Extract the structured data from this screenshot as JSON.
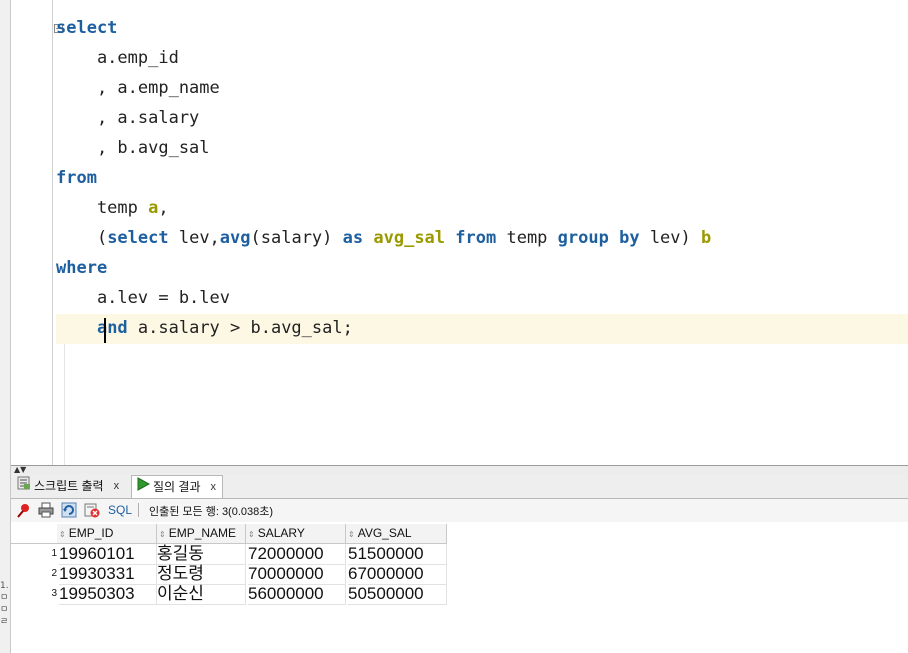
{
  "editor": {
    "lines": [
      [
        {
          "t": "select",
          "c": "kw"
        }
      ],
      [
        {
          "t": "    a.emp_id",
          "c": ""
        }
      ],
      [
        {
          "t": "    , a.emp_name",
          "c": ""
        }
      ],
      [
        {
          "t": "    , a.salary",
          "c": ""
        }
      ],
      [
        {
          "t": "    , b.avg_sal",
          "c": ""
        }
      ],
      [
        {
          "t": "from",
          "c": "kw"
        }
      ],
      [
        {
          "t": "    temp ",
          "c": ""
        },
        {
          "t": "a",
          "c": "al"
        },
        {
          "t": ",",
          "c": ""
        }
      ],
      [
        {
          "t": "    (",
          "c": ""
        },
        {
          "t": "select",
          "c": "kw"
        },
        {
          "t": " lev,",
          "c": ""
        },
        {
          "t": "avg",
          "c": "kw"
        },
        {
          "t": "(salary) ",
          "c": ""
        },
        {
          "t": "as",
          "c": "kw"
        },
        {
          "t": " ",
          "c": ""
        },
        {
          "t": "avg_sal",
          "c": "al"
        },
        {
          "t": " ",
          "c": ""
        },
        {
          "t": "from",
          "c": "kw"
        },
        {
          "t": " temp ",
          "c": ""
        },
        {
          "t": "group",
          "c": "kw"
        },
        {
          "t": " ",
          "c": ""
        },
        {
          "t": "by",
          "c": "kw"
        },
        {
          "t": " lev) ",
          "c": ""
        },
        {
          "t": "b",
          "c": "al"
        }
      ],
      [
        {
          "t": "where",
          "c": "kw"
        }
      ],
      [
        {
          "t": "    a.lev = b.lev",
          "c": ""
        }
      ],
      [
        {
          "t": "    ",
          "c": ""
        },
        {
          "t": "and",
          "c": "kw"
        },
        {
          "t": " a.salary > b.avg_sal;",
          "c": ""
        }
      ]
    ],
    "fold_symbol": "−"
  },
  "tabs": {
    "script_output": "스크립트 출력",
    "query_result": "질의 결과",
    "close": "x"
  },
  "toolbar": {
    "sql_label": "SQL",
    "status": "인출된 모든 행: 3(0.038초)"
  },
  "grid": {
    "columns": [
      "EMP_ID",
      "EMP_NAME",
      "SALARY",
      "AVG_SAL"
    ],
    "rows": [
      {
        "num": "1",
        "cells": [
          "19960101",
          "홍길동",
          "72000000",
          "51500000"
        ]
      },
      {
        "num": "2",
        "cells": [
          "19930331",
          "정도령",
          "70000000",
          "67000000"
        ]
      },
      {
        "num": "3",
        "cells": [
          "19950303",
          "이순신",
          "56000000",
          "50500000"
        ]
      }
    ]
  },
  "colors": {
    "keyword": "#1e5fa0",
    "alias": "#9a9a00",
    "current_line": "#fdf8e4"
  }
}
